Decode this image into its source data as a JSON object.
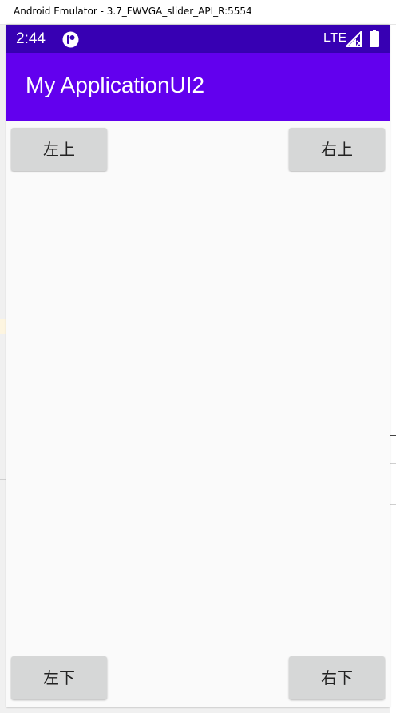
{
  "window": {
    "title": "Android Emulator - 3.7_FWVGA_slider_API_R:5554"
  },
  "status_bar": {
    "time": "2:44",
    "network": "LTE",
    "color": "#3700b3",
    "icons": [
      "notification-icon",
      "signal-icon",
      "battery-icon"
    ]
  },
  "app_bar": {
    "title": "My ApplicationUI2",
    "color": "#6200ee"
  },
  "buttons": {
    "top_left": "左上",
    "top_right": "右上",
    "bottom_left": "左下",
    "bottom_right": "右下"
  }
}
